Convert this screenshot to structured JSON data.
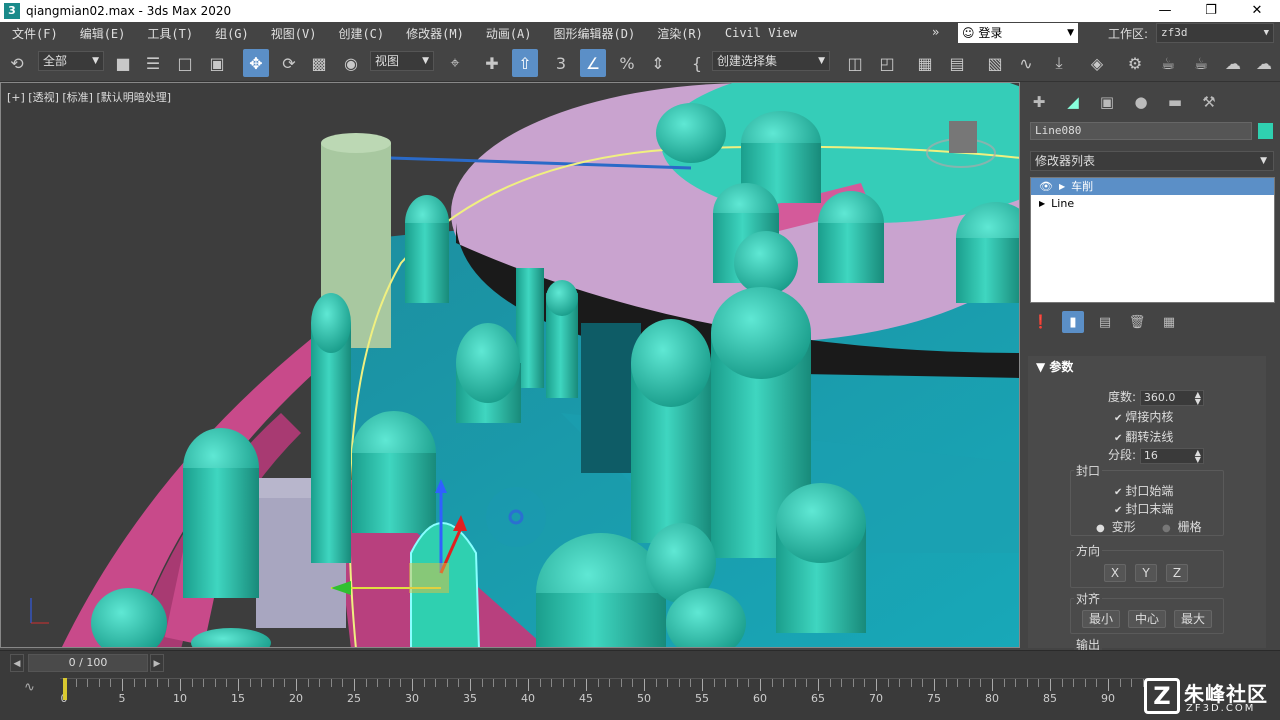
{
  "window": {
    "title": "qiangmian02.max - 3ds Max 2020",
    "app_icon": "3",
    "controls": [
      "—",
      "❐",
      "✕"
    ]
  },
  "menu": {
    "items": [
      "文件(F)",
      "编辑(E)",
      "工具(T)",
      "组(G)",
      "视图(V)",
      "创建(C)",
      "修改器(M)",
      "动画(A)",
      "图形编辑器(D)",
      "渲染(R)",
      "Civil View"
    ],
    "overflow": "»",
    "login": "登录",
    "workspace_label": "工作区:",
    "workspace_value": "zf3d"
  },
  "toolbar": {
    "selection_filter": "全部",
    "reference_coord": "视图",
    "named_selection": "创建选择集"
  },
  "viewport": {
    "label": "[+] [透视] [标准] [默认明暗处理]"
  },
  "command_panel": {
    "object_name": "Line080",
    "object_color": "#2fd0b0",
    "modifier_list": "修改器列表",
    "stack": [
      {
        "label": "车削",
        "selected": true
      },
      {
        "label": "Line",
        "selected": false
      }
    ],
    "rollout_title": "参数",
    "degrees_label": "度数:",
    "degrees_value": "360.0",
    "weld_core": "焊接内核",
    "flip_normals": "翻转法线",
    "segments_label": "分段:",
    "segments_value": "16",
    "capping_title": "封口",
    "cap_start": "封口始端",
    "cap_end": "封口末端",
    "morph": "变形",
    "grid": "栅格",
    "direction_title": "方向",
    "dir_x": "X",
    "dir_y": "Y",
    "dir_z": "Z",
    "align_title": "对齐",
    "align_min": "最小",
    "align_center": "中心",
    "align_max": "最大",
    "output_title": "输出"
  },
  "timeline": {
    "frame_display": "0 / 100",
    "ticks": [
      0,
      5,
      10,
      15,
      20,
      25,
      30,
      35,
      40,
      45,
      50,
      55,
      60,
      65,
      70,
      75,
      80,
      85,
      90
    ]
  },
  "watermark": {
    "name": "朱峰社区",
    "url": "ZF3D.COM",
    "mark": "Z"
  }
}
